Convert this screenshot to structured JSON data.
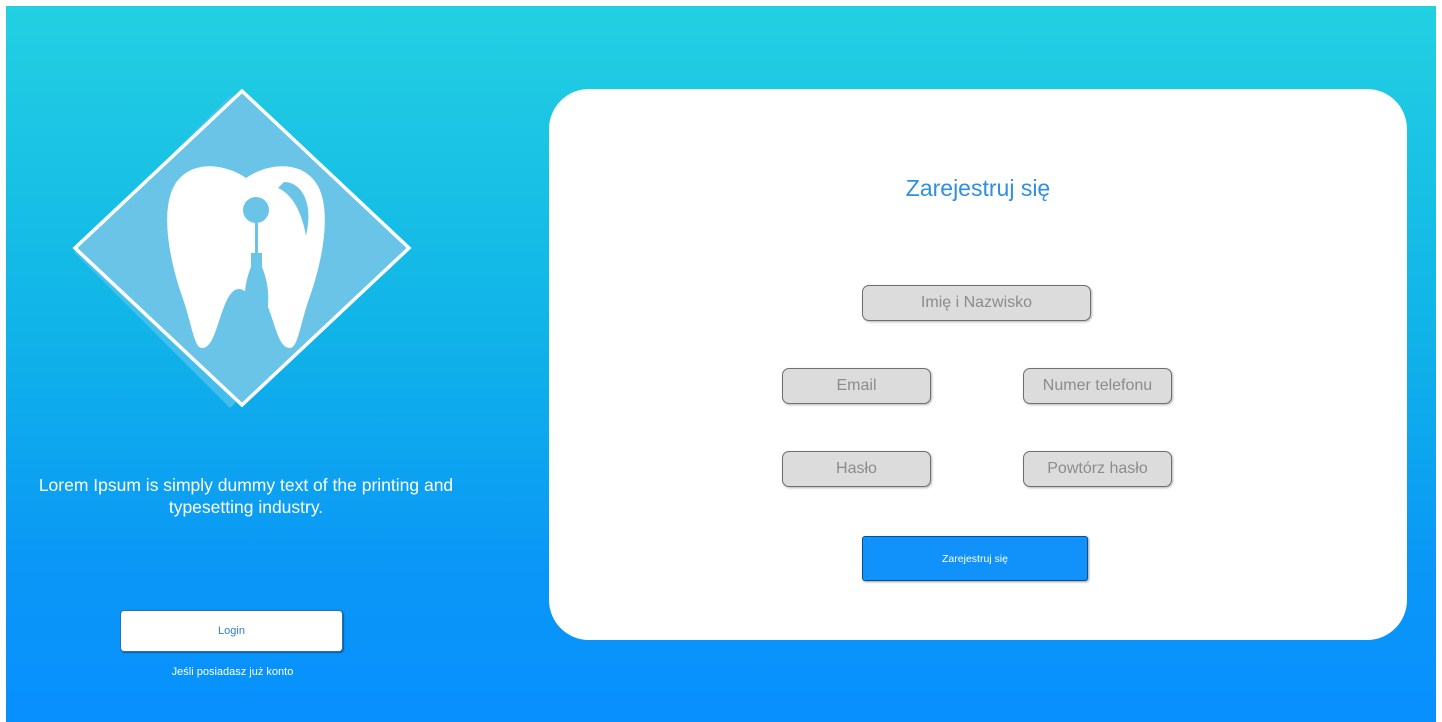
{
  "left_panel": {
    "tagline": "Lorem Ipsum is simply dummy text of the printing and typesetting industry.",
    "login_button_label": "Login",
    "login_hint": "Jeśli posiadasz już konto",
    "logo_icon": "tooth-diamond-logo"
  },
  "register_card": {
    "title": "Zarejestruj się",
    "fields": {
      "full_name_placeholder": "Imię i Nazwisko",
      "email_placeholder": "Email",
      "phone_placeholder": "Numer telefonu",
      "password_placeholder": "Hasło",
      "password_repeat_placeholder": "Powtórz hasło"
    },
    "submit_label": "Zarejestruj się"
  },
  "colors": {
    "gradient_top": "#23d0e1",
    "gradient_bottom": "#0890ff",
    "accent_blue": "#2e8fe6",
    "button_blue": "#1192fb",
    "field_bg": "#dcdcdc",
    "card_bg": "#ffffff"
  }
}
